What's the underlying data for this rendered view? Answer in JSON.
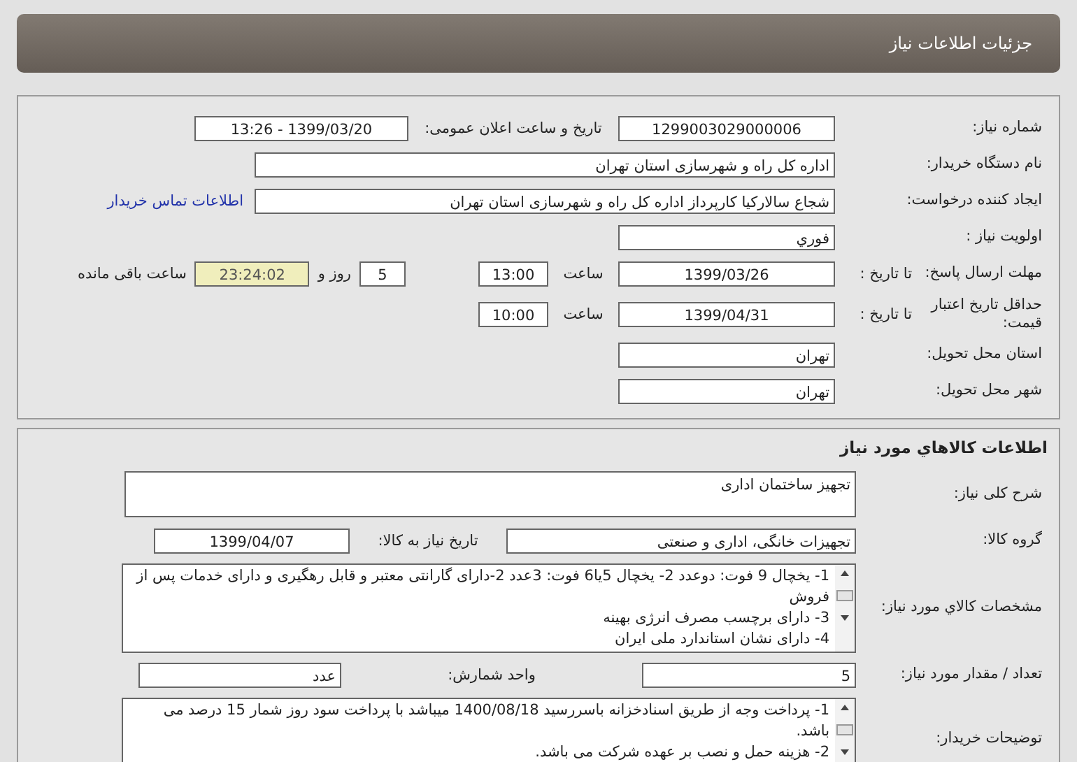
{
  "header": {
    "title": "جزئیات اطلاعات نیاز"
  },
  "need_info": {
    "need_number": {
      "label": "شماره نیاز:",
      "value": "1299003029000006"
    },
    "announce": {
      "label": "تاریخ و ساعت اعلان عمومی:",
      "value": "1399/03/20 - 13:26"
    },
    "buyer_org": {
      "label": "نام دستگاه خریدار:",
      "value": "اداره کل راه و شهرسازی استان تهران"
    },
    "requester": {
      "label": "ایجاد کننده درخواست:",
      "value": "شجاع سالارکیا کارپرداز اداره کل راه و شهرسازی استان تهران"
    },
    "contact_link": "اطلاعات تماس خریدار",
    "priority": {
      "label": "اولویت نیاز :",
      "value": "فوري"
    },
    "deadline": {
      "label": "مهلت ارسال پاسخ:",
      "to_date_label": "تا تاریخ :",
      "date": "1399/03/26",
      "time_label": "ساعت",
      "time": "13:00",
      "days": "5",
      "days_label": "روز و",
      "remaining": "23:24:02",
      "remaining_label": "ساعت باقی مانده"
    },
    "validity": {
      "label": "حداقل تاریخ اعتبار قیمت:",
      "to_date_label": "تا تاریخ :",
      "date": "1399/04/31",
      "time_label": "ساعت",
      "time": "10:00"
    },
    "province": {
      "label": "استان محل تحویل:",
      "value": "تهران"
    },
    "city": {
      "label": "شهر محل تحویل:",
      "value": "تهران"
    }
  },
  "goods": {
    "title": "اطلاعات کالاهاي مورد نیاز",
    "description": {
      "label": "شرح کلی نیاز:",
      "value": "تجهیز ساختمان اداری"
    },
    "group": {
      "label": "گروه کالا:",
      "value": "تجهیزات خانگی، اداری و صنعتی"
    },
    "need_date": {
      "label": "تاریخ نیاز به کالا:",
      "value": "1399/04/07"
    },
    "specs": {
      "label": "مشخصات کالاي مورد نیاز:",
      "lines": [
        "1- یخچال 9 فوت:  دوعدد  2- یخچال 5یا6 فوت:  3عدد    2-دارای گارانتی معتبر و قابل رهگیری و دارای خدمات پس از فروش",
        "3- دارای برچسب مصرف انرژی بهینه",
        "4- دارای نشان استاندارد ملی ایران"
      ]
    },
    "quantity": {
      "label": "تعداد / مقدار مورد نیاز:",
      "value": "5"
    },
    "unit": {
      "label": "واحد شمارش:",
      "value": "عدد"
    },
    "buyer_notes": {
      "label": "توضیحات خریدار:",
      "lines": [
        "1- پرداخت وجه از طریق اسنادخزانه باسررسید 1400/08/18 میباشد با پرداخت سود روز شمار 15 درصد می باشد.",
        "2- هزینه حمل و نصب بر عهده شرکت می باشد."
      ]
    }
  }
}
